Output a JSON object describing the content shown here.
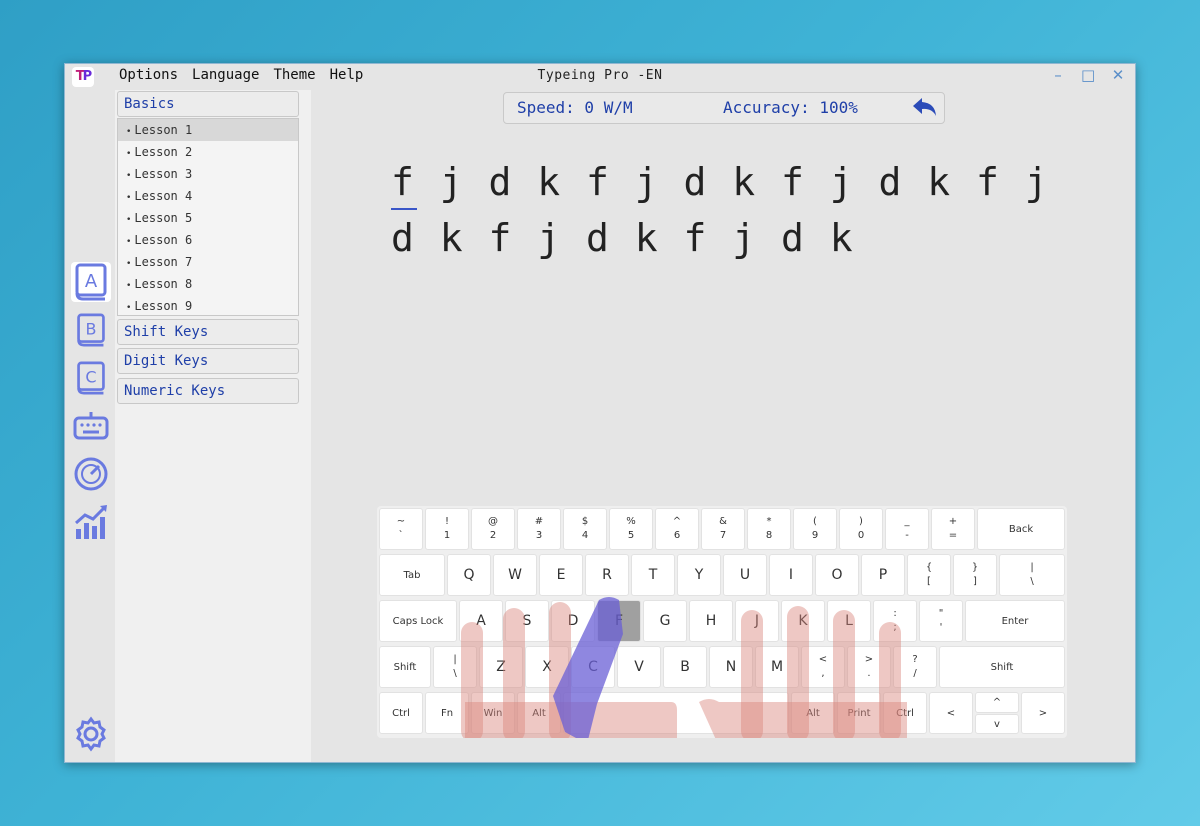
{
  "app": {
    "title": "Typeing Pro -EN",
    "logo": "TP"
  },
  "menu": {
    "options": "Options",
    "language": "Language",
    "theme": "Theme",
    "help": "Help"
  },
  "window_controls": {
    "minimize": "–",
    "maximize": "□",
    "close": "✕"
  },
  "iconbar": [
    "book-a-icon",
    "book-b-icon",
    "book-c-icon",
    "keyboard-icon",
    "speedometer-icon",
    "stats-chart-icon",
    "settings-gear-icon"
  ],
  "sidebar": {
    "basics": "Basics",
    "lessons": [
      "Lesson 1",
      "Lesson 2",
      "Lesson 3",
      "Lesson 4",
      "Lesson 5",
      "Lesson 6",
      "Lesson 7",
      "Lesson 8",
      "Lesson 9"
    ],
    "shift": "Shift Keys",
    "digit": "Digit Keys",
    "numeric": "Numeric Keys"
  },
  "stats": {
    "speed": "Speed: 0 W/M",
    "accuracy": "Accuracy: 100%"
  },
  "practice": {
    "line1": [
      "f",
      "j",
      "d",
      "k",
      "f",
      "j",
      "d",
      "k",
      "f",
      "j",
      "d",
      "k",
      "f",
      "j"
    ],
    "line2": [
      "d",
      "k",
      "f",
      "j",
      "d",
      "k",
      "f",
      "j",
      "d",
      "k"
    ]
  },
  "keyboard": {
    "r1": [
      [
        "~",
        "`"
      ],
      [
        "!",
        "1"
      ],
      [
        "@",
        "2"
      ],
      [
        "#",
        "3"
      ],
      [
        "$",
        "4"
      ],
      [
        "%",
        "5"
      ],
      [
        "^",
        "6"
      ],
      [
        "&",
        "7"
      ],
      [
        "*",
        "8"
      ],
      [
        "(",
        "9"
      ],
      [
        ")",
        "0"
      ],
      [
        "_",
        "-"
      ],
      [
        "+",
        "="
      ]
    ],
    "back": "Back",
    "tab": "Tab",
    "r2": [
      "Q",
      "W",
      "E",
      "R",
      "T",
      "Y",
      "U",
      "I",
      "O",
      "P"
    ],
    "r2s": [
      [
        "{",
        "["
      ],
      [
        "}",
        "]"
      ],
      [
        "|",
        "\\"
      ]
    ],
    "caps": "Caps Lock",
    "r3": [
      "A",
      "S",
      "D",
      "F",
      "G",
      "H",
      "J",
      "K",
      "L"
    ],
    "r3s": [
      [
        ":",
        ";"
      ],
      [
        "\"",
        "'"
      ]
    ],
    "enter": "Enter",
    "shift": "Shift",
    "shift_left_sym": [
      "|",
      "\\"
    ],
    "r4": [
      "Z",
      "X",
      "C",
      "V",
      "B",
      "N",
      "M"
    ],
    "r4s": [
      [
        "<",
        ","
      ],
      [
        ">",
        "."
      ],
      [
        "?",
        "/"
      ]
    ],
    "ctrl": "Ctrl",
    "fn": "Fn",
    "win": "Win",
    "alt": "Alt",
    "print": "Print",
    "left": "<",
    "up": "^",
    "down": "v",
    "right": ">"
  },
  "colors": {
    "accent": "#1f3fa8",
    "icon": "#6a7ae0",
    "highlight_finger": "#6a5fd6"
  }
}
